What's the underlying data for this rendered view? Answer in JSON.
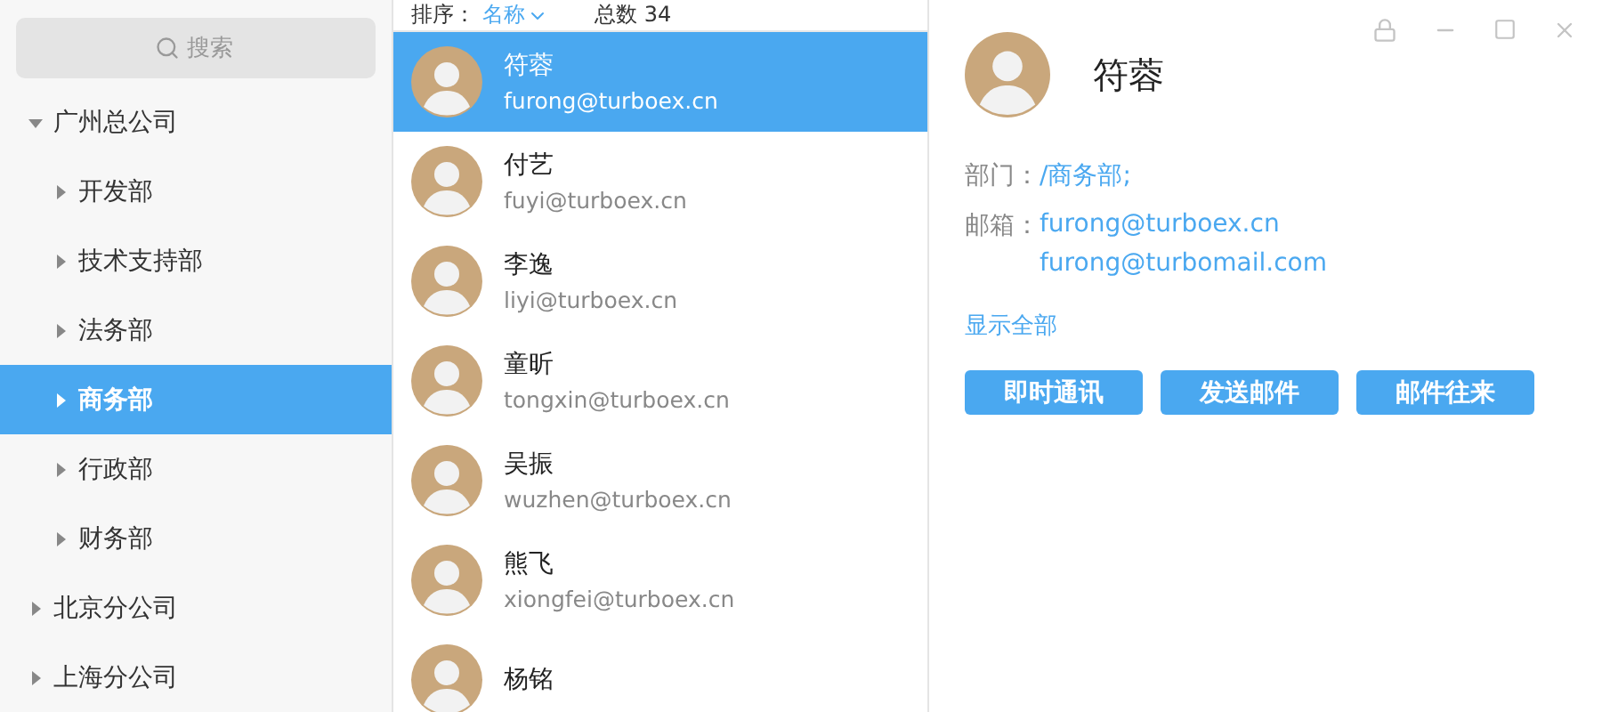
{
  "search": {
    "placeholder": "搜索"
  },
  "tree": [
    {
      "label": "广州总公司",
      "expanded": true,
      "selected": false,
      "children": [
        {
          "label": "开发部",
          "expanded": false,
          "selected": false
        },
        {
          "label": "技术支持部",
          "expanded": false,
          "selected": false
        },
        {
          "label": "法务部",
          "expanded": false,
          "selected": false
        },
        {
          "label": "商务部",
          "expanded": false,
          "selected": true
        },
        {
          "label": "行政部",
          "expanded": false,
          "selected": false
        },
        {
          "label": "财务部",
          "expanded": false,
          "selected": false
        }
      ]
    },
    {
      "label": "北京分公司",
      "expanded": false,
      "selected": false
    },
    {
      "label": "上海分公司",
      "expanded": false,
      "selected": false
    }
  ],
  "list_header": {
    "sort_label": "排序：",
    "sort_value": "名称",
    "total": "总数 34"
  },
  "contacts": [
    {
      "name": "符蓉",
      "email": "furong@turboex.cn",
      "selected": true
    },
    {
      "name": "付艺",
      "email": "fuyi@turboex.cn",
      "selected": false
    },
    {
      "name": "李逸",
      "email": "liyi@turboex.cn",
      "selected": false
    },
    {
      "name": "童昕",
      "email": "tongxin@turboex.cn",
      "selected": false
    },
    {
      "name": "吴振",
      "email": "wuzhen@turboex.cn",
      "selected": false
    },
    {
      "name": "熊飞",
      "email": "xiongfei@turboex.cn",
      "selected": false
    },
    {
      "name": "杨铭",
      "selected": false
    }
  ],
  "detail": {
    "name": "符蓉",
    "fields": [
      {
        "label": "部门：",
        "values": [
          "/商务部;"
        ]
      },
      {
        "label": "邮箱：",
        "values": [
          "furong@turboex.cn",
          "furong@turbomail.com"
        ]
      }
    ],
    "show_all": "显示全部",
    "buttons": [
      "即时通讯",
      "发送邮件",
      "邮件往来"
    ]
  }
}
